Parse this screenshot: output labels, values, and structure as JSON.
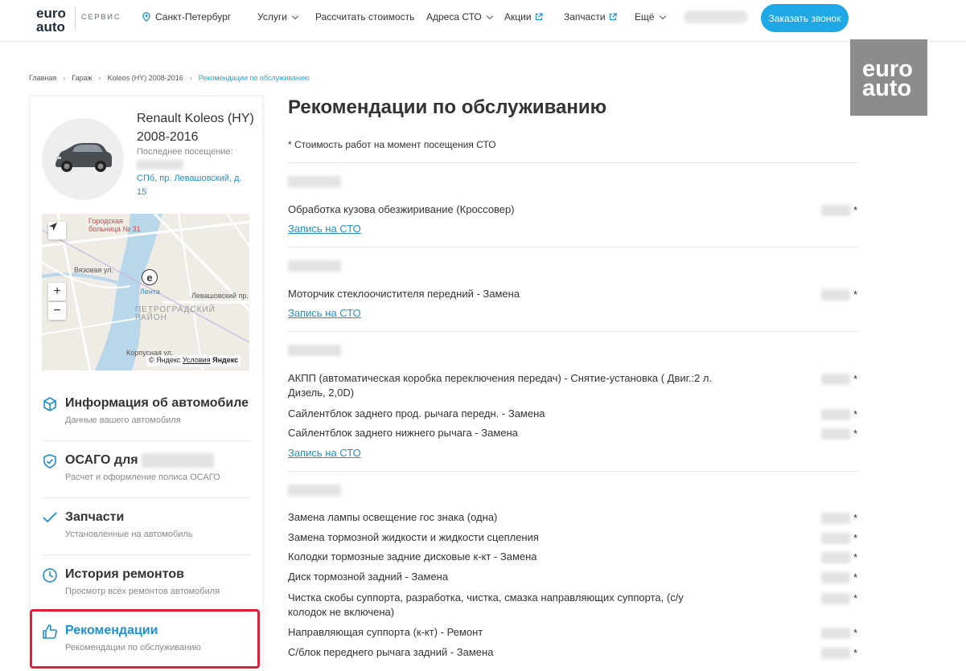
{
  "header": {
    "logo_line1": "euro",
    "logo_line2": "auto",
    "logo_service": "СЕРВИС",
    "city": "Санкт-Петербург",
    "nav": [
      {
        "label": "Услуги",
        "icon": "chevron-down-icon"
      },
      {
        "label": "Рассчитать стоимость",
        "icon": ""
      },
      {
        "label": "Адреса СТО",
        "icon": "chevron-down-icon"
      },
      {
        "label": "Акции",
        "icon": "external-link-icon"
      },
      {
        "label": "Запчасти",
        "icon": "external-link-icon"
      },
      {
        "label": "Ещё",
        "icon": "chevron-down-icon"
      }
    ],
    "call_button": "Заказать звонок"
  },
  "watermark": {
    "line1": "euro",
    "line2": "auto"
  },
  "breadcrumbs": [
    "Главная",
    "Гараж",
    "Koleos (HY) 2008-2016",
    "Рекомендации по обслуживанию"
  ],
  "car": {
    "name": "Renault Koleos (HY) 2008-2016",
    "last_visit_label": "Последнее посещение:",
    "address": "СПб, пр. Левашовский, д. 15"
  },
  "map": {
    "labels": {
      "hospital": "Городская больница № 31",
      "lenta": "Лента",
      "district": "ПЕТРОГРАДСКИЙ РАЙОН",
      "street1": "Левашовский пр.",
      "street2": "Вязовая ул.",
      "street3": "Корпусная ул."
    },
    "zoom_in": "+",
    "zoom_out": "−",
    "copyright": "© Яндекс",
    "terms": "Условия",
    "brand": "Яндекс"
  },
  "menu": [
    {
      "title": "Информация об автомобиле",
      "subtitle": "Данные вашего автомобиля",
      "icon": "cube-icon"
    },
    {
      "title": "ОСАГО для",
      "subtitle": "Расчет и оформление полиса ОСАГО",
      "icon": "shield-check-icon"
    },
    {
      "title": "Запчасти",
      "subtitle": "Установленные на автомобиль",
      "icon": "checkmark-icon"
    },
    {
      "title": "История ремонтов",
      "subtitle": "Просмотр всех ремонтов автомобиля",
      "icon": "clock-icon"
    },
    {
      "title": "Рекомендации",
      "subtitle": "Рекомендации по обслуживанию",
      "icon": "thumbs-up-icon"
    }
  ],
  "main": {
    "title": "Рекомендации по обслуживанию",
    "note": "* Стоимость работ на момент посещения СТО",
    "link_label": "Запись на СТО",
    "asterisk": "*",
    "groups": [
      {
        "items": [
          "Обработка кузова обезжиривание (Кроссовер)"
        ]
      },
      {
        "items": [
          "Моторчик стеклоочистителя передний - Замена"
        ]
      },
      {
        "items": [
          "АКПП (автоматическая коробка переключения передач) - Снятие-установка ( Двиг.:2 л. Дизель, 2,0D)",
          "Сайлентблок заднего прод. рычага передн. - Замена",
          "Сайлентблок заднего нижнего рычага - Замена"
        ]
      },
      {
        "items": [
          "Замена лампы освещение гос знака (одна)",
          "Замена тормозной жидкости и жидкости сцепления",
          "Колодки тормозные задние дисковые к-кт - Замена",
          "Диск тормозной задний - Замена",
          "Чистка скобы суппорта, разработка, чистка, смазка направляющих суппорта, (с/у колодок не включена)",
          "Направляющая суппорта (к-кт) - Ремонт",
          "С/блок переднего рычага задний - Замена"
        ]
      }
    ]
  },
  "colors": {
    "accent": "#1ea8e6",
    "link": "#1e8fd0",
    "highlight": "#e01e37",
    "watermark_bg": "#8c8c8c"
  }
}
